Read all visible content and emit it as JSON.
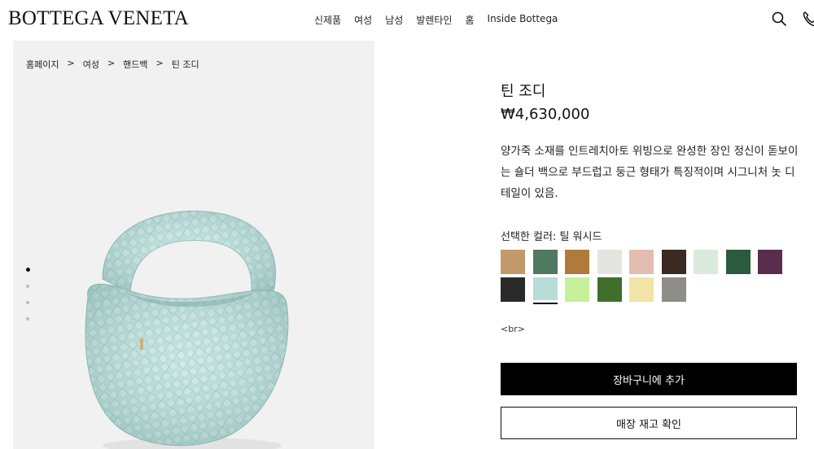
{
  "header": {
    "logo": "BOTTEGA VENETA",
    "nav": [
      "신제품",
      "여성",
      "남성",
      "발렌타인",
      "홈",
      "Inside Bottega"
    ],
    "icons": [
      "search-icon",
      "phone-icon"
    ]
  },
  "breadcrumb": [
    "홈페이지",
    "여성",
    "핸드백",
    "틴 조디"
  ],
  "breadcrumb_separator": ">",
  "gallery": {
    "image_count": 4,
    "active_index": 0,
    "bag_color": "#b8dcd8"
  },
  "product": {
    "title": "틴 조디",
    "price": "₩4,630,000",
    "description": "양가죽 소재를 인트레치아토 위빙으로 완성한 장인 정신이 돋보이는 숄더 백으로 부드럽고 둥근 형태가 특징적이며 시그니처 놋 디테일이 있음.",
    "color_label": "선택한 컬러: 틸 워시드",
    "swatches": [
      "#c29a6a",
      "#4f7a5f",
      "#b07a3c",
      "#e6e4df",
      "#e3bdb0",
      "#3a2a22",
      "#d9ebdd",
      "#2b5a3f",
      "#5a2d4d",
      "#2a2a2a",
      "#b8dcd8",
      "#c6f09a",
      "#3f6f2a",
      "#f1e4a6",
      "#8e8e86"
    ],
    "selected_swatch": 10,
    "br_text": "<br>",
    "cart_button": "장바구니에 추가",
    "stock_button": "매장 재고 확인"
  }
}
